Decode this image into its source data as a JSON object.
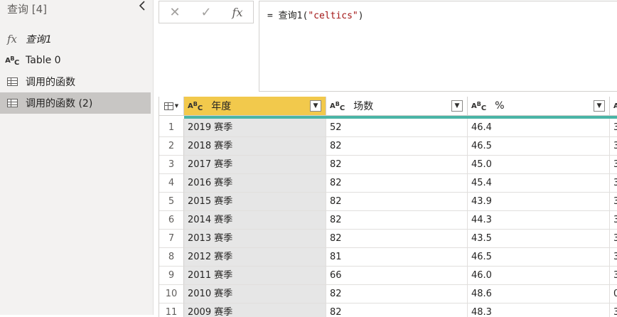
{
  "queries_pane": {
    "title": "查询 [4]",
    "collapse_icon": "chevron-left",
    "items": [
      {
        "label": "查询1",
        "icon": "fx-icon",
        "selected": false
      },
      {
        "label": "Table 0",
        "icon": "text-type-icon",
        "selected": false
      },
      {
        "label": "调用的函数",
        "icon": "table-icon",
        "selected": false
      },
      {
        "label": "调用的函数 (2)",
        "icon": "table-icon",
        "selected": true
      }
    ]
  },
  "formula_bar": {
    "cancel_icon": "✕",
    "confirm_icon": "✓",
    "fx_label": "fx",
    "formula_prefix": "= 查询1(",
    "formula_string": "\"celtics\"",
    "formula_suffix": ")"
  },
  "grid": {
    "type_label_a": "A",
    "type_label_b": "B",
    "type_label_c": "C",
    "columns": [
      {
        "name": "年度",
        "type": "text",
        "selected": true
      },
      {
        "name": "场数",
        "type": "text",
        "selected": false
      },
      {
        "name": "%",
        "type": "text",
        "selected": false
      },
      {
        "name": "",
        "type": "text",
        "selected": false
      }
    ],
    "rows": [
      {
        "index": "1",
        "year": "2019 赛季",
        "games": "52",
        "pct": "46.4",
        "next": "3"
      },
      {
        "index": "2",
        "year": "2018 赛季",
        "games": "82",
        "pct": "46.5",
        "next": "3"
      },
      {
        "index": "3",
        "year": "2017 赛季",
        "games": "82",
        "pct": "45.0",
        "next": "3"
      },
      {
        "index": "4",
        "year": "2016 赛季",
        "games": "82",
        "pct": "45.4",
        "next": "3"
      },
      {
        "index": "5",
        "year": "2015 赛季",
        "games": "82",
        "pct": "43.9",
        "next": "3"
      },
      {
        "index": "6",
        "year": "2014 赛季",
        "games": "82",
        "pct": "44.3",
        "next": "3"
      },
      {
        "index": "7",
        "year": "2013 赛季",
        "games": "82",
        "pct": "43.5",
        "next": "3"
      },
      {
        "index": "8",
        "year": "2012 赛季",
        "games": "81",
        "pct": "46.5",
        "next": "3"
      },
      {
        "index": "9",
        "year": "2011 赛季",
        "games": "66",
        "pct": "46.0",
        "next": "3"
      },
      {
        "index": "10",
        "year": "2010 赛季",
        "games": "82",
        "pct": "48.6",
        "next": "0"
      },
      {
        "index": "11",
        "year": "2009 赛季",
        "games": "82",
        "pct": "48.3",
        "next": "3"
      }
    ],
    "quality_bar_color": "#4ab5a6",
    "selected_header_color": "#f2c94c"
  }
}
